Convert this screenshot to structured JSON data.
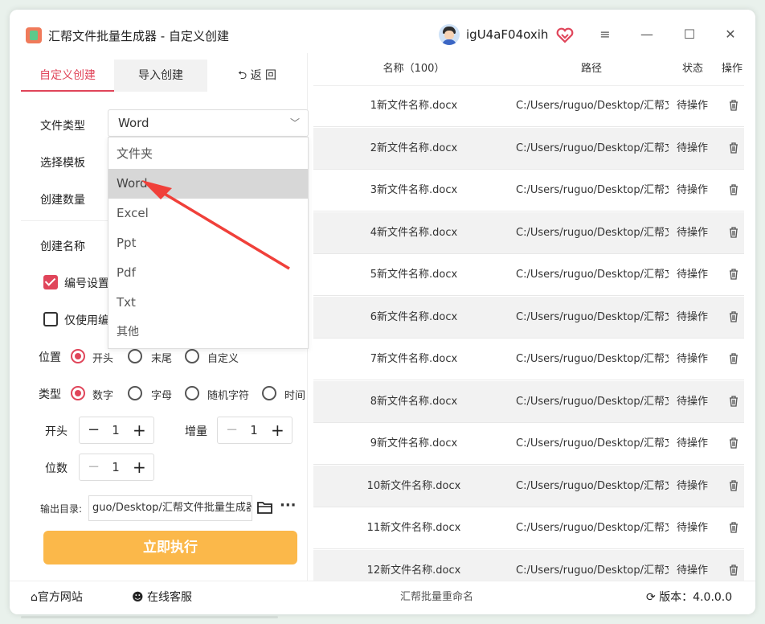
{
  "app": {
    "title": "汇帮文件批量生成器 - 自定义创建",
    "username": "igU4aF04oxih"
  },
  "window_controls": {
    "menu": "≡",
    "minimize": "—",
    "maximize": "☐",
    "close": "✕"
  },
  "tabs": [
    {
      "label": "自定义创建"
    },
    {
      "label": "导入创建"
    },
    {
      "label": "返  回"
    }
  ],
  "form": {
    "file_type_label": "文件类型",
    "file_type_value": "Word",
    "template_label": "选择模板",
    "count_label": "创建数量",
    "name_label": "创建名称",
    "numbering_label": "编号设置",
    "numbering_checked": true,
    "only_number_label": "仅使用编",
    "only_number_checked": false,
    "position_label": "位置",
    "position_options": [
      "开头",
      "末尾",
      "自定义"
    ],
    "position_selected": "开头",
    "type_label": "类型",
    "type_options": [
      "数字",
      "字母",
      "随机字符",
      "时间"
    ],
    "type_selected": "数字",
    "start_label": "开头",
    "start_value": "1",
    "increment_label": "增量",
    "increment_value": "1",
    "digits_label": "位数",
    "digits_value": "1",
    "output_label": "输出目录:",
    "output_value": "guo/Desktop/汇帮文件批量生成器",
    "run_label": "立即执行"
  },
  "dropdown": {
    "options": [
      "文件夹",
      "Word",
      "Excel",
      "Ppt",
      "Pdf",
      "Txt",
      "其他"
    ],
    "highlighted": "Word"
  },
  "table": {
    "headers": {
      "name": "名称（100）",
      "path": "路径",
      "status": "状态",
      "action": "操作"
    },
    "rows": [
      {
        "name": "1新文件名称.docx",
        "path": "C:/Users/ruguo/Desktop/汇帮文",
        "status": "待操作"
      },
      {
        "name": "2新文件名称.docx",
        "path": "C:/Users/ruguo/Desktop/汇帮文",
        "status": "待操作"
      },
      {
        "name": "3新文件名称.docx",
        "path": "C:/Users/ruguo/Desktop/汇帮文",
        "status": "待操作"
      },
      {
        "name": "4新文件名称.docx",
        "path": "C:/Users/ruguo/Desktop/汇帮文",
        "status": "待操作"
      },
      {
        "name": "5新文件名称.docx",
        "path": "C:/Users/ruguo/Desktop/汇帮文",
        "status": "待操作"
      },
      {
        "name": "6新文件名称.docx",
        "path": "C:/Users/ruguo/Desktop/汇帮文",
        "status": "待操作"
      },
      {
        "name": "7新文件名称.docx",
        "path": "C:/Users/ruguo/Desktop/汇帮文",
        "status": "待操作"
      },
      {
        "name": "8新文件名称.docx",
        "path": "C:/Users/ruguo/Desktop/汇帮文",
        "status": "待操作"
      },
      {
        "name": "9新文件名称.docx",
        "path": "C:/Users/ruguo/Desktop/汇帮文",
        "status": "待操作"
      },
      {
        "name": "10新文件名称.docx",
        "path": "C:/Users/ruguo/Desktop/汇帮文",
        "status": "待操作"
      },
      {
        "name": "11新文件名称.docx",
        "path": "C:/Users/ruguo/Desktop/汇帮文",
        "status": "待操作"
      },
      {
        "name": "12新文件名称.docx",
        "path": "C:/Users/ruguo/Desktop/汇帮文",
        "status": "待操作"
      }
    ]
  },
  "footer": {
    "website": "官方网站",
    "support": "在线客服",
    "center": "汇帮批量重命名",
    "version": "版本：4.0.0.0"
  },
  "colors": {
    "accent": "#e0455a",
    "run_button": "#fbb84a",
    "arrow": "#f0403a"
  }
}
